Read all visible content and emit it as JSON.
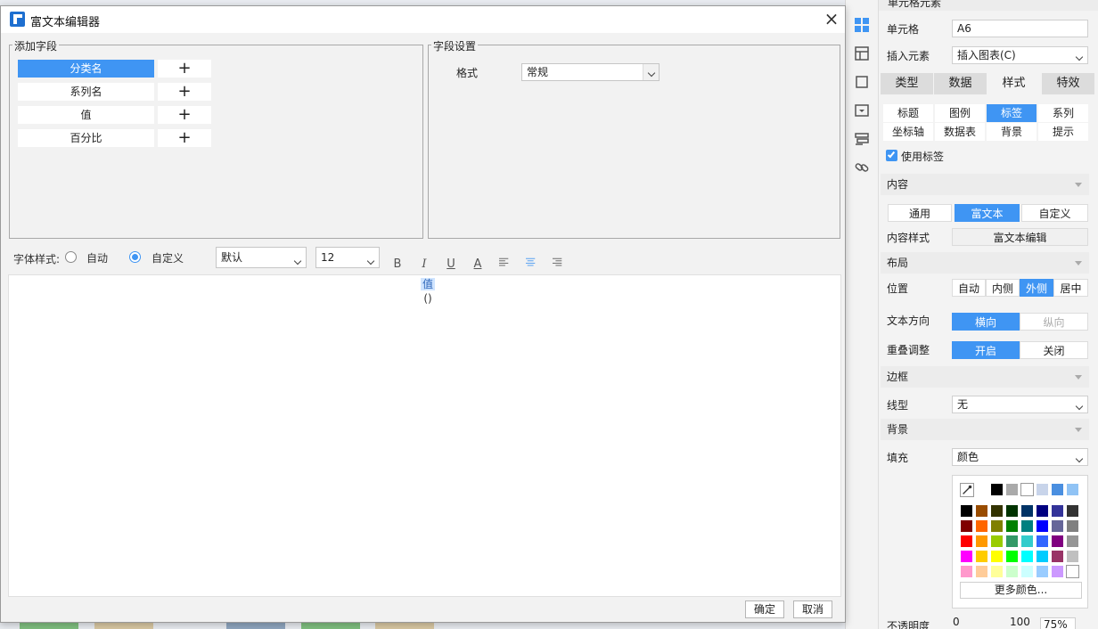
{
  "dialog": {
    "title": "富文本编辑器",
    "add_field_group": "添加字段",
    "fields": [
      {
        "name": "分类名",
        "selected": true
      },
      {
        "name": "系列名",
        "selected": false
      },
      {
        "name": "值",
        "selected": false
      },
      {
        "name": "百分比",
        "selected": false
      }
    ],
    "add_symbol": "+",
    "field_settings_group": "字段设置",
    "format_label": "格式",
    "format_value": "常规",
    "font_style_label": "字体样式:",
    "radio_auto": "自动",
    "radio_custom": "自定义",
    "font_family_value": "默认",
    "font_size_value": "12",
    "editor_token": "值",
    "editor_paren": "()",
    "ok": "确定",
    "cancel": "取消"
  },
  "panel": {
    "header_partial": "单元格元素",
    "cell_label": "单元格",
    "cell_value": "A6",
    "insert_label": "插入元素",
    "insert_value": "插入图表(C)",
    "tabs": [
      "类型",
      "数据",
      "样式",
      "特效"
    ],
    "active_tab": "样式",
    "sub_tabs_row1": [
      "标题",
      "图例",
      "标签",
      "系列"
    ],
    "sub_tabs_row2": [
      "坐标轴",
      "数据表",
      "背景",
      "提示"
    ],
    "active_sub_tab": "标签",
    "use_label": "使用标签",
    "section_content": "内容",
    "content_modes": [
      "通用",
      "富文本",
      "自定义"
    ],
    "active_content_mode": "富文本",
    "content_style_label": "内容样式",
    "content_style_button": "富文本编辑",
    "section_layout": "布局",
    "position_label": "位置",
    "positions": [
      "自动",
      "内侧",
      "外侧",
      "居中"
    ],
    "active_position": "外侧",
    "text_dir_label": "文本方向",
    "text_dirs": [
      "横向",
      "纵向"
    ],
    "overlap_label": "重叠调整",
    "overlap_opts": [
      "开启",
      "关闭"
    ],
    "section_border": "边框",
    "line_type_label": "线型",
    "line_type_value": "无",
    "section_background": "背景",
    "fill_label": "填充",
    "fill_value": "颜色",
    "more_colors": "更多颜色...",
    "opacity_label": "不透明度",
    "opacity_min": "0",
    "opacity_max": "100",
    "opacity_value": "75%"
  },
  "colors": {
    "accent": "#3f95f3",
    "recent": [
      "#000000",
      "#aaaaaa",
      "#ffffff",
      "#c8d4ea",
      "#4a8fe0",
      "#90c3f5"
    ],
    "grid": [
      [
        "#000000",
        "#994c00",
        "#333300",
        "#003300",
        "#003366",
        "#000080",
        "#333399",
        "#333333"
      ],
      [
        "#800000",
        "#ff6600",
        "#808000",
        "#008000",
        "#008080",
        "#0000ff",
        "#666699",
        "#808080"
      ],
      [
        "#ff0000",
        "#ff9900",
        "#99cc00",
        "#339966",
        "#33cccc",
        "#3366ff",
        "#800080",
        "#969696"
      ],
      [
        "#ff00ff",
        "#ffcc00",
        "#ffff00",
        "#00ff00",
        "#00ffff",
        "#00ccff",
        "#993366",
        "#c0c0c0"
      ],
      [
        "#ff99cc",
        "#ffcc99",
        "#ffff99",
        "#ccffcc",
        "#ccffff",
        "#99ccff",
        "#cc99ff",
        "#ffffff"
      ]
    ]
  }
}
